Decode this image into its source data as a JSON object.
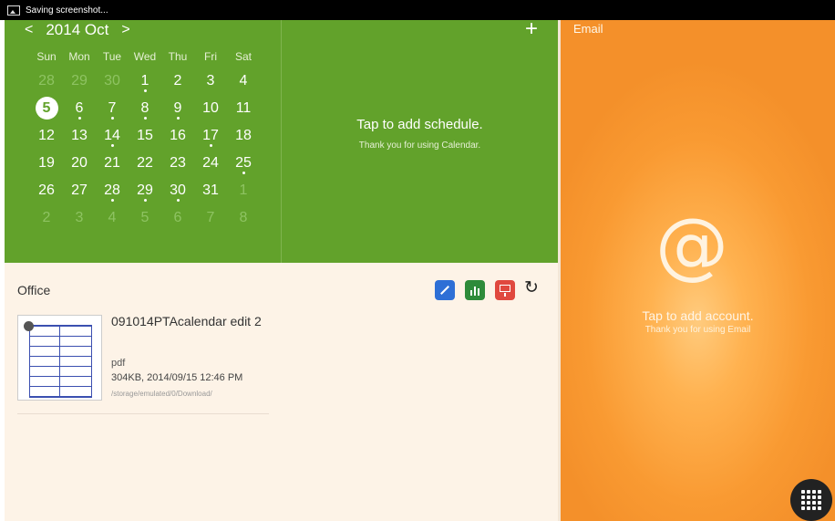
{
  "status_bar": {
    "text": "Saving screenshot..."
  },
  "calendar": {
    "year_month": "2014 Oct",
    "prev_arrow": "<",
    "next_arrow": ">",
    "add_label": "+",
    "weekdays": [
      "Sun",
      "Mon",
      "Tue",
      "Wed",
      "Thu",
      "Fri",
      "Sat"
    ],
    "days": [
      {
        "label": "28",
        "muted": true
      },
      {
        "label": "29",
        "muted": true
      },
      {
        "label": "30",
        "muted": true
      },
      {
        "label": "1",
        "event": true
      },
      {
        "label": "2"
      },
      {
        "label": "3"
      },
      {
        "label": "4"
      },
      {
        "label": "5",
        "today": true
      },
      {
        "label": "6",
        "event": true
      },
      {
        "label": "7",
        "event": true
      },
      {
        "label": "8",
        "event": true
      },
      {
        "label": "9",
        "event": true
      },
      {
        "label": "10"
      },
      {
        "label": "11"
      },
      {
        "label": "12"
      },
      {
        "label": "13"
      },
      {
        "label": "14",
        "event": true
      },
      {
        "label": "15"
      },
      {
        "label": "16"
      },
      {
        "label": "17",
        "event": true
      },
      {
        "label": "18"
      },
      {
        "label": "19"
      },
      {
        "label": "20"
      },
      {
        "label": "21"
      },
      {
        "label": "22"
      },
      {
        "label": "23"
      },
      {
        "label": "24"
      },
      {
        "label": "25",
        "event": true
      },
      {
        "label": "26"
      },
      {
        "label": "27"
      },
      {
        "label": "28",
        "event": true
      },
      {
        "label": "29",
        "event": true
      },
      {
        "label": "30",
        "event": true
      },
      {
        "label": "31"
      },
      {
        "label": "1",
        "muted": true
      },
      {
        "label": "2",
        "muted": true
      },
      {
        "label": "3",
        "muted": true
      },
      {
        "label": "4",
        "muted": true
      },
      {
        "label": "5",
        "muted": true
      },
      {
        "label": "6",
        "muted": true
      },
      {
        "label": "7",
        "muted": true
      },
      {
        "label": "8",
        "muted": true
      }
    ],
    "schedule_title": "Tap to add schedule.",
    "schedule_sub": "Thank you for using Calendar."
  },
  "office": {
    "title": "Office",
    "icons": [
      "word-app-icon",
      "excel-app-icon",
      "powerpoint-app-icon",
      "refresh-icon"
    ],
    "refresh_glyph": "↻",
    "document": {
      "name": "091014PTAcalendar edit 2",
      "type": "pdf",
      "meta": "304KB, 2014/09/15 12:46 PM",
      "path": "/storage/emulated/0/Download/"
    }
  },
  "email": {
    "title": "Email",
    "at_glyph": "@",
    "hint_title": "Tap to add account.",
    "hint_sub": "Thank you for using Email"
  },
  "colors": {
    "calendar_green": "#62a22b",
    "office_bg": "#fdf3e7",
    "email_orange": "#f99a32",
    "word_blue": "#2e6fd6",
    "excel_green": "#2e8b3a",
    "ppt_red": "#e0483e"
  }
}
